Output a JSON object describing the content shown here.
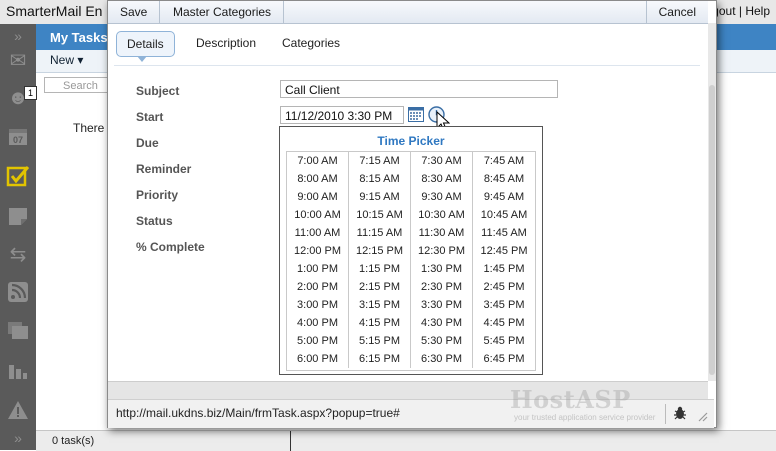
{
  "app": {
    "title": "SmarterMail En",
    "header_links": "gout | Help",
    "tasks_title": "My Tasks",
    "new_label": "New ▾",
    "search_placeholder": "Search",
    "empty_message": "There",
    "status_count": "0 task(s)",
    "inbox_badge": "1",
    "rail_icons": [
      "collapse-icon",
      "mail-icon",
      "contacts-icon",
      "calendar-icon",
      "tasks-icon",
      "notes-icon",
      "sync-icon",
      "rss-icon",
      "folders-icon",
      "reports-icon",
      "alerts-icon",
      "expand-icon"
    ]
  },
  "popup": {
    "toolbar": {
      "save": "Save",
      "master_categories": "Master Categories",
      "cancel": "Cancel"
    },
    "tabs": [
      {
        "label": "Details",
        "active": true
      },
      {
        "label": "Description",
        "active": false
      },
      {
        "label": "Categories",
        "active": false
      }
    ],
    "fields": {
      "subject_label": "Subject",
      "subject_value": "Call Client",
      "start_label": "Start",
      "start_value": "11/12/2010 3:30 PM",
      "due_label": "Due",
      "reminder_label": "Reminder",
      "priority_label": "Priority",
      "status_label": "Status",
      "complete_label": "% Complete"
    },
    "time_picker": {
      "title": "Time Picker",
      "times": [
        "7:00 AM",
        "7:15 AM",
        "7:30 AM",
        "7:45 AM",
        "8:00 AM",
        "8:15 AM",
        "8:30 AM",
        "8:45 AM",
        "9:00 AM",
        "9:15 AM",
        "9:30 AM",
        "9:45 AM",
        "10:00 AM",
        "10:15 AM",
        "10:30 AM",
        "10:45 AM",
        "11:00 AM",
        "11:15 AM",
        "11:30 AM",
        "11:45 AM",
        "12:00 PM",
        "12:15 PM",
        "12:30 PM",
        "12:45 PM",
        "1:00 PM",
        "1:15 PM",
        "1:30 PM",
        "1:45 PM",
        "2:00 PM",
        "2:15 PM",
        "2:30 PM",
        "2:45 PM",
        "3:00 PM",
        "3:15 PM",
        "3:30 PM",
        "3:45 PM",
        "4:00 PM",
        "4:15 PM",
        "4:30 PM",
        "4:45 PM",
        "5:00 PM",
        "5:15 PM",
        "5:30 PM",
        "5:45 PM",
        "6:00 PM",
        "6:15 PM",
        "6:30 PM",
        "6:45 PM"
      ]
    },
    "status_url": "http://mail.ukdns.biz/Main/frmTask.aspx?popup=true#",
    "watermark": "HostASP",
    "watermark_tagline": "your trusted application service provider"
  },
  "colors": {
    "accent": "#3e84c4",
    "picker_title": "#2f78c1",
    "tasks_active_icon": "#e2c400"
  }
}
